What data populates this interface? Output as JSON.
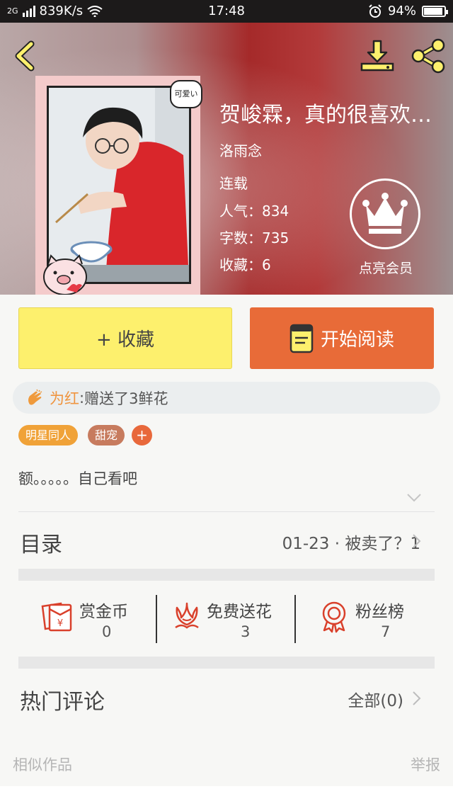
{
  "status_bar": {
    "network": "2G",
    "speed": "839K/s",
    "time": "17:48",
    "battery": "94%",
    "battery_level": 0.94
  },
  "book": {
    "title": "贺峻霖，真的很喜欢…",
    "author": "洛雨念",
    "status": "连载",
    "popularity_label": "人气：",
    "popularity": "834",
    "words_label": "字数：",
    "words": "735",
    "favorites_label": "收藏：",
    "favorites": "6",
    "cover_sticker": "可爱い"
  },
  "vip": {
    "label": "点亮会员"
  },
  "actions": {
    "collect": "+ 收藏",
    "read": "开始阅读"
  },
  "gift": {
    "user": "为红",
    "separator": ":",
    "message": "赠送了3鲜花"
  },
  "tags": [
    {
      "label": "明星同人",
      "color": "#f0a238"
    },
    {
      "label": "甜宠",
      "color": "#c77b5e"
    }
  ],
  "tag_add": "+",
  "description": "额。。。。。自己看吧",
  "toc": {
    "title": "目录",
    "latest": "01-23 · 被卖了？1"
  },
  "stats": [
    {
      "label": "赏金币",
      "value": "0",
      "icon": "red-envelope-icon"
    },
    {
      "label": "免费送花",
      "value": "3",
      "icon": "flower-icon"
    },
    {
      "label": "粉丝榜",
      "value": "7",
      "icon": "medal-icon"
    }
  ],
  "comments": {
    "title": "热门评论",
    "all": "全部(0)"
  },
  "footer": {
    "similar": "相似作品",
    "report": "举报"
  },
  "colors": {
    "accent_yellow": "#fdf06d",
    "accent_orange": "#e86b38",
    "icon_red": "#d9402b"
  }
}
